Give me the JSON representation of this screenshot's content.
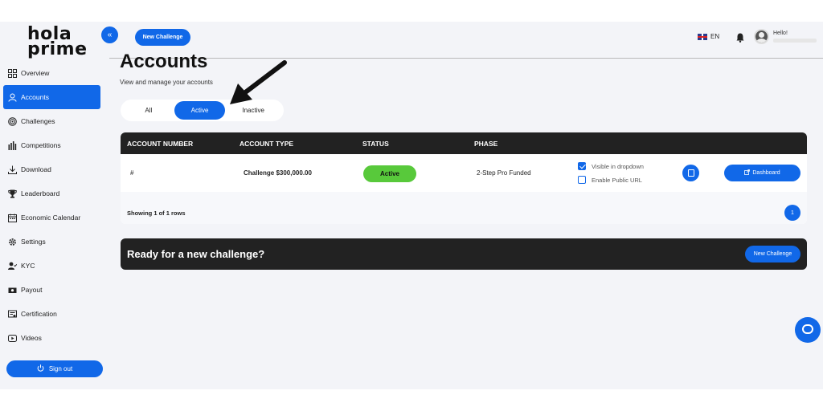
{
  "brand": {
    "line1": "hola",
    "line2": "prime"
  },
  "sidebar": {
    "collapse_icon": "double-chevron-left",
    "items": [
      {
        "label": "Overview",
        "icon": "grid-icon"
      },
      {
        "label": "Accounts",
        "icon": "user-icon",
        "active": true
      },
      {
        "label": "Challenges",
        "icon": "target-icon"
      },
      {
        "label": "Competitions",
        "icon": "bar-chart-icon"
      },
      {
        "label": "Download",
        "icon": "download-icon"
      },
      {
        "label": "Leaderboard",
        "icon": "trophy-icon"
      },
      {
        "label": "Economic Calendar",
        "icon": "calendar-icon"
      },
      {
        "label": "Settings",
        "icon": "gear-icon"
      },
      {
        "label": "KYC",
        "icon": "user-check-icon"
      },
      {
        "label": "Payout",
        "icon": "payout-icon"
      },
      {
        "label": "Certification",
        "icon": "certificate-icon"
      },
      {
        "label": "Videos",
        "icon": "video-icon"
      }
    ],
    "signout_label": "Sign out"
  },
  "header": {
    "new_challenge_label": "New Challenge",
    "language": "EN",
    "greeting": "Hello!"
  },
  "page": {
    "title": "Accounts",
    "subtitle": "View and manage your accounts",
    "tabs": [
      {
        "label": "All"
      },
      {
        "label": "Active",
        "selected": true
      },
      {
        "label": "Inactive"
      }
    ]
  },
  "table": {
    "columns": [
      "ACCOUNT NUMBER",
      "ACCOUNT TYPE",
      "STATUS",
      "PHASE"
    ],
    "rows": [
      {
        "account_number": "#",
        "account_type": "Challenge $300,000.00",
        "status": "Active",
        "phase": "2-Step Pro Funded",
        "visible_in_dropdown_label": "Visible in dropdown",
        "visible_in_dropdown": true,
        "public_url_label": "Enable Public URL",
        "public_url": false,
        "dashboard_label": "Dashboard"
      }
    ],
    "footer": {
      "showing": "Showing 1 of 1 rows",
      "page": "1"
    }
  },
  "banner": {
    "text": "Ready for a new challenge?",
    "button_label": "New Challenge"
  },
  "colors": {
    "accent": "#1168e8",
    "status_active": "#58c93b",
    "dark": "#222222"
  }
}
